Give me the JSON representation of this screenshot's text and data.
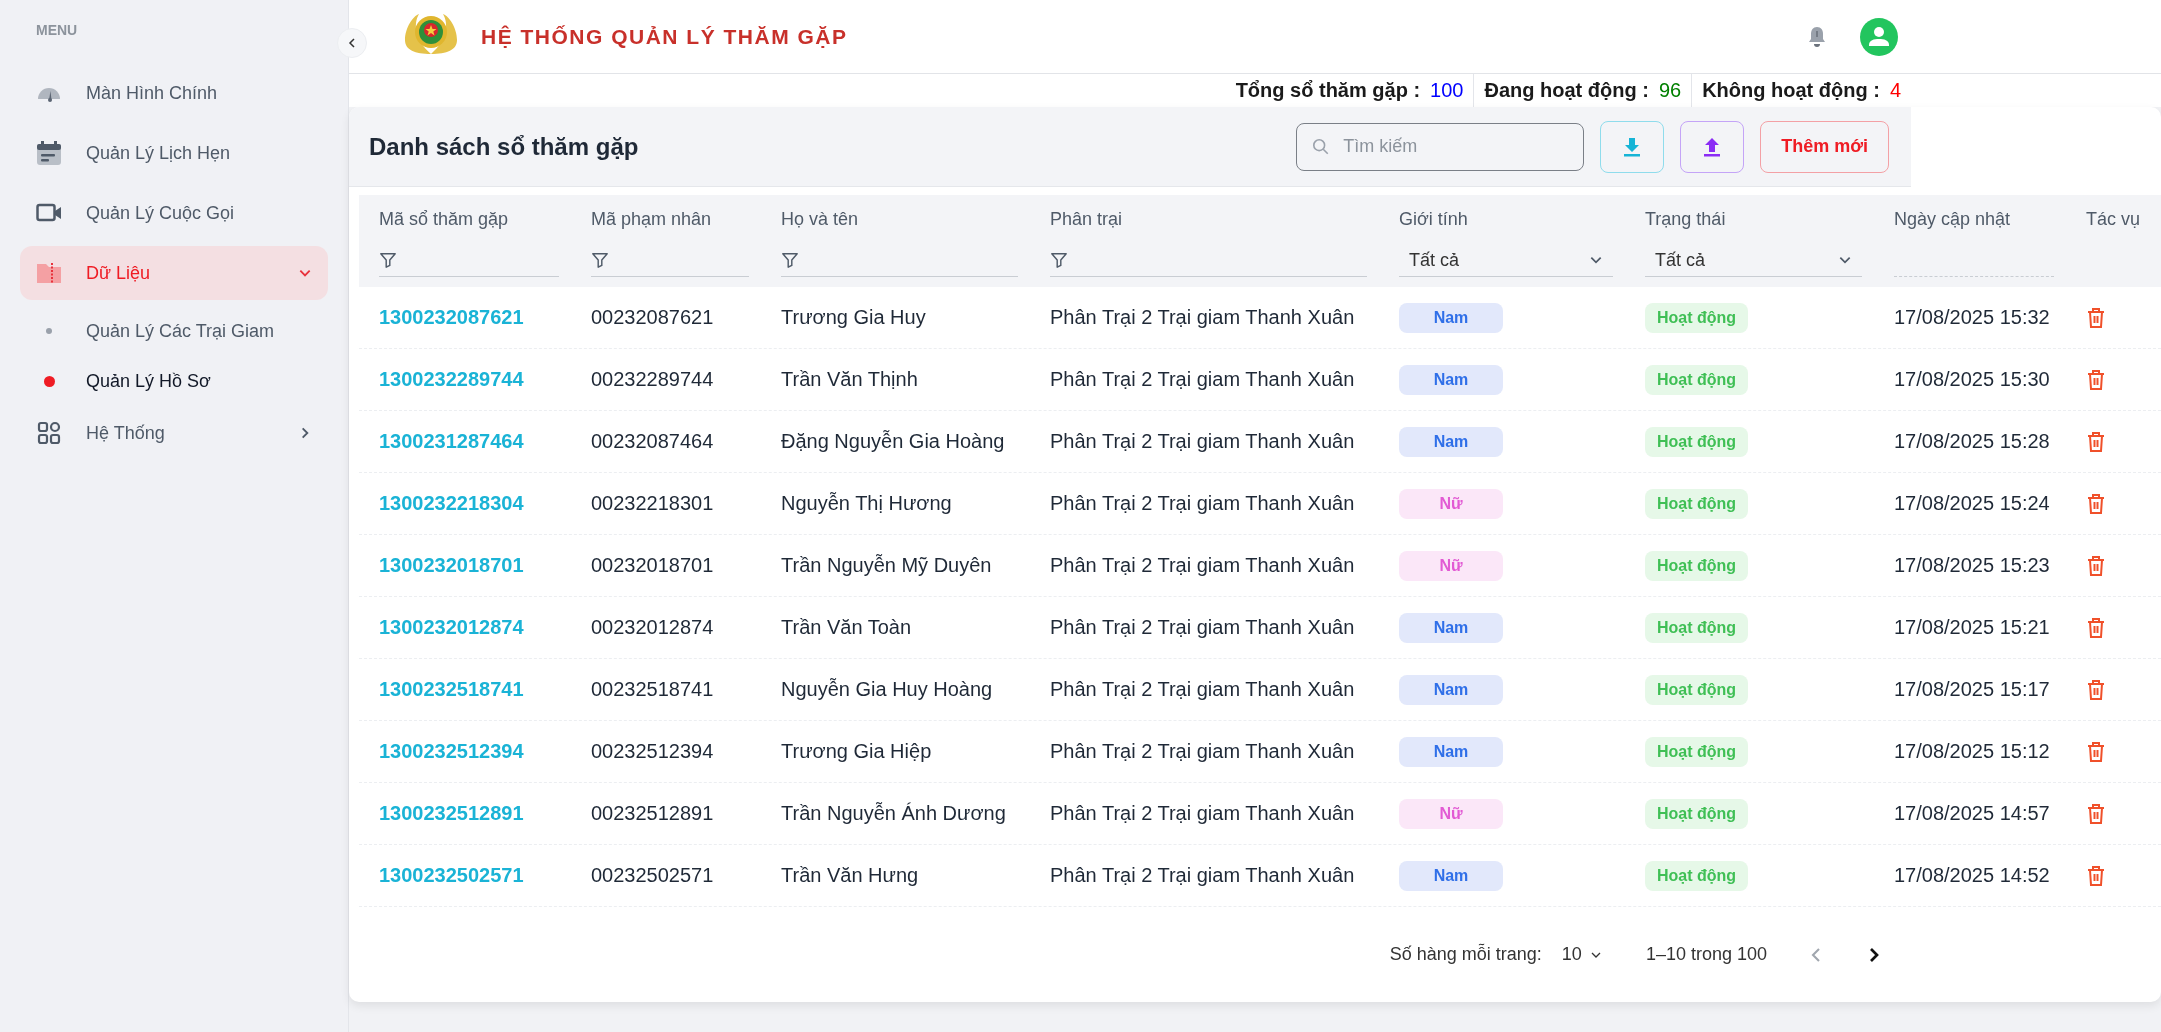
{
  "sidebar": {
    "menu_label": "MENU",
    "items": [
      {
        "label": "Màn Hình Chính",
        "selected": false
      },
      {
        "label": "Quản Lý Lịch Hẹn",
        "selected": false
      },
      {
        "label": "Quản Lý Cuộc Gọi",
        "selected": false
      },
      {
        "label": "Dữ Liệu",
        "selected": true,
        "expanded": true,
        "children": [
          {
            "label": "Quản Lý Các Trại Giam",
            "selected": false
          },
          {
            "label": "Quản Lý Hồ Sơ",
            "selected": true
          }
        ]
      },
      {
        "label": "Hệ Thống",
        "selected": false,
        "expanded": false
      }
    ]
  },
  "header": {
    "title": "HỆ THỐNG QUẢN LÝ THĂM GẶP"
  },
  "stats": [
    {
      "label": "Tổng sổ thăm gặp :",
      "value": "100",
      "color": "#0000ff"
    },
    {
      "label": "Đang hoạt động :",
      "value": "96",
      "color": "#008000"
    },
    {
      "label": "Không hoạt động :",
      "value": "4",
      "color": "#ff0000"
    }
  ],
  "card": {
    "title": "Danh sách sổ thăm gặp",
    "search": {
      "placeholder": "Tìm kiếm"
    },
    "add_button": "Thêm mới"
  },
  "table": {
    "columns": [
      {
        "label": "Mã sổ thăm gặp",
        "kind": "text"
      },
      {
        "label": "Mã phạm nhân",
        "kind": "text"
      },
      {
        "label": "Họ và tên",
        "kind": "text"
      },
      {
        "label": "Phân trại",
        "kind": "text"
      },
      {
        "label": "Giới tính",
        "kind": "select",
        "value": "Tất cả"
      },
      {
        "label": "Trạng thái",
        "kind": "select",
        "value": "Tất cả"
      },
      {
        "label": "Ngày cập nhật",
        "kind": "line"
      },
      {
        "label": "Tác vụ",
        "kind": "plain"
      }
    ],
    "rows": [
      {
        "code": "1300232087621",
        "inmate": "00232087621",
        "name": "Trương Gia Huy",
        "camp": "Phân Trại 2 Trại giam Thanh Xuân",
        "gender": {
          "label": "Nam",
          "kind": "male"
        },
        "status": {
          "label": "Hoạt động",
          "kind": "active"
        },
        "updated": "17/08/2025 15:32"
      },
      {
        "code": "1300232289744",
        "inmate": "00232289744",
        "name": "Trần Văn Thịnh",
        "camp": "Phân Trại 2 Trại giam Thanh Xuân",
        "gender": {
          "label": "Nam",
          "kind": "male"
        },
        "status": {
          "label": "Hoạt động",
          "kind": "active"
        },
        "updated": "17/08/2025 15:30"
      },
      {
        "code": "1300231287464",
        "inmate": "00232087464",
        "name": "Đặng Nguyễn Gia Hoàng",
        "camp": "Phân Trại 2 Trại giam Thanh Xuân",
        "gender": {
          "label": "Nam",
          "kind": "male"
        },
        "status": {
          "label": "Hoạt động",
          "kind": "active"
        },
        "updated": "17/08/2025 15:28"
      },
      {
        "code": "1300232218304",
        "inmate": "00232218301",
        "name": "Nguyễn Thị Hương",
        "camp": "Phân Trại 2 Trại giam Thanh Xuân",
        "gender": {
          "label": "Nữ",
          "kind": "female"
        },
        "status": {
          "label": "Hoạt động",
          "kind": "active"
        },
        "updated": "17/08/2025 15:24"
      },
      {
        "code": "1300232018701",
        "inmate": "00232018701",
        "name": "Trần Nguyễn Mỹ Duyên",
        "camp": "Phân Trại 2 Trại giam Thanh Xuân",
        "gender": {
          "label": "Nữ",
          "kind": "female"
        },
        "status": {
          "label": "Hoạt động",
          "kind": "active"
        },
        "updated": "17/08/2025 15:23"
      },
      {
        "code": "1300232012874",
        "inmate": "00232012874",
        "name": "Trần Văn Toàn",
        "camp": "Phân Trại 2 Trại giam Thanh Xuân",
        "gender": {
          "label": "Nam",
          "kind": "male"
        },
        "status": {
          "label": "Hoạt động",
          "kind": "active"
        },
        "updated": "17/08/2025 15:21"
      },
      {
        "code": "1300232518741",
        "inmate": "00232518741",
        "name": "Nguyễn Gia Huy Hoàng",
        "camp": "Phân Trại 2 Trại giam Thanh Xuân",
        "gender": {
          "label": "Nam",
          "kind": "male"
        },
        "status": {
          "label": "Hoạt động",
          "kind": "active"
        },
        "updated": "17/08/2025 15:17"
      },
      {
        "code": "1300232512394",
        "inmate": "00232512394",
        "name": "Trương Gia Hiệp",
        "camp": "Phân Trại 2 Trại giam Thanh Xuân",
        "gender": {
          "label": "Nam",
          "kind": "male"
        },
        "status": {
          "label": "Hoạt động",
          "kind": "active"
        },
        "updated": "17/08/2025 15:12"
      },
      {
        "code": "1300232512891",
        "inmate": "00232512891",
        "name": "Trần Nguyễn Ánh Dương",
        "camp": "Phân Trại 2 Trại giam Thanh Xuân",
        "gender": {
          "label": "Nữ",
          "kind": "female"
        },
        "status": {
          "label": "Hoạt động",
          "kind": "active"
        },
        "updated": "17/08/2025 14:57"
      },
      {
        "code": "1300232502571",
        "inmate": "00232502571",
        "name": "Trần Văn Hưng",
        "camp": "Phân Trại 2 Trại giam Thanh Xuân",
        "gender": {
          "label": "Nam",
          "kind": "male"
        },
        "status": {
          "label": "Hoạt động",
          "kind": "active"
        },
        "updated": "17/08/2025 14:52"
      }
    ]
  },
  "pagination": {
    "rows_label": "Số hàng mỗi trang:",
    "rows_value": "10",
    "range": "1–10 trong 100"
  }
}
